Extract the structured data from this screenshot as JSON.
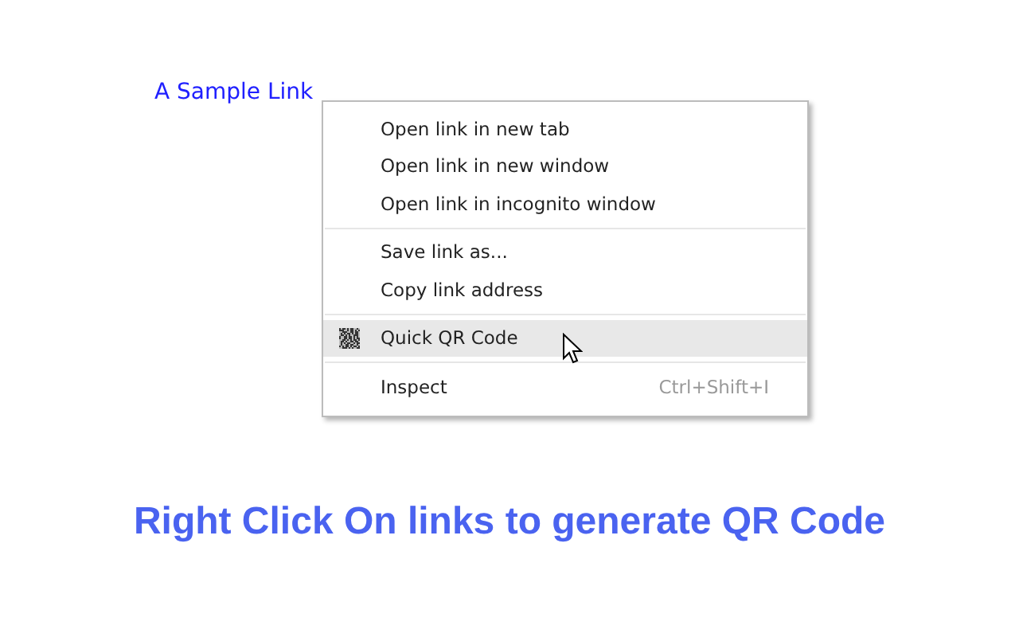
{
  "link": {
    "text": "A Sample Link"
  },
  "context_menu": {
    "groups": [
      [
        {
          "kind": "plain",
          "label": "Open link in new tab",
          "highlighted": false
        },
        {
          "kind": "plain",
          "label": "Open link in new window",
          "highlighted": false
        },
        {
          "kind": "plain",
          "label": "Open link in incognito window",
          "highlighted": false
        }
      ],
      [
        {
          "kind": "plain",
          "label": "Save link as...",
          "highlighted": false
        },
        {
          "kind": "plain",
          "label": "Copy link address",
          "highlighted": false
        }
      ],
      [
        {
          "kind": "qr",
          "label": "Quick QR Code",
          "highlighted": true
        }
      ],
      [
        {
          "kind": "plain",
          "label": "Inspect",
          "shortcut": "Ctrl+Shift+I",
          "highlighted": false
        }
      ]
    ]
  },
  "caption": "Right Click On links to generate QR Code"
}
